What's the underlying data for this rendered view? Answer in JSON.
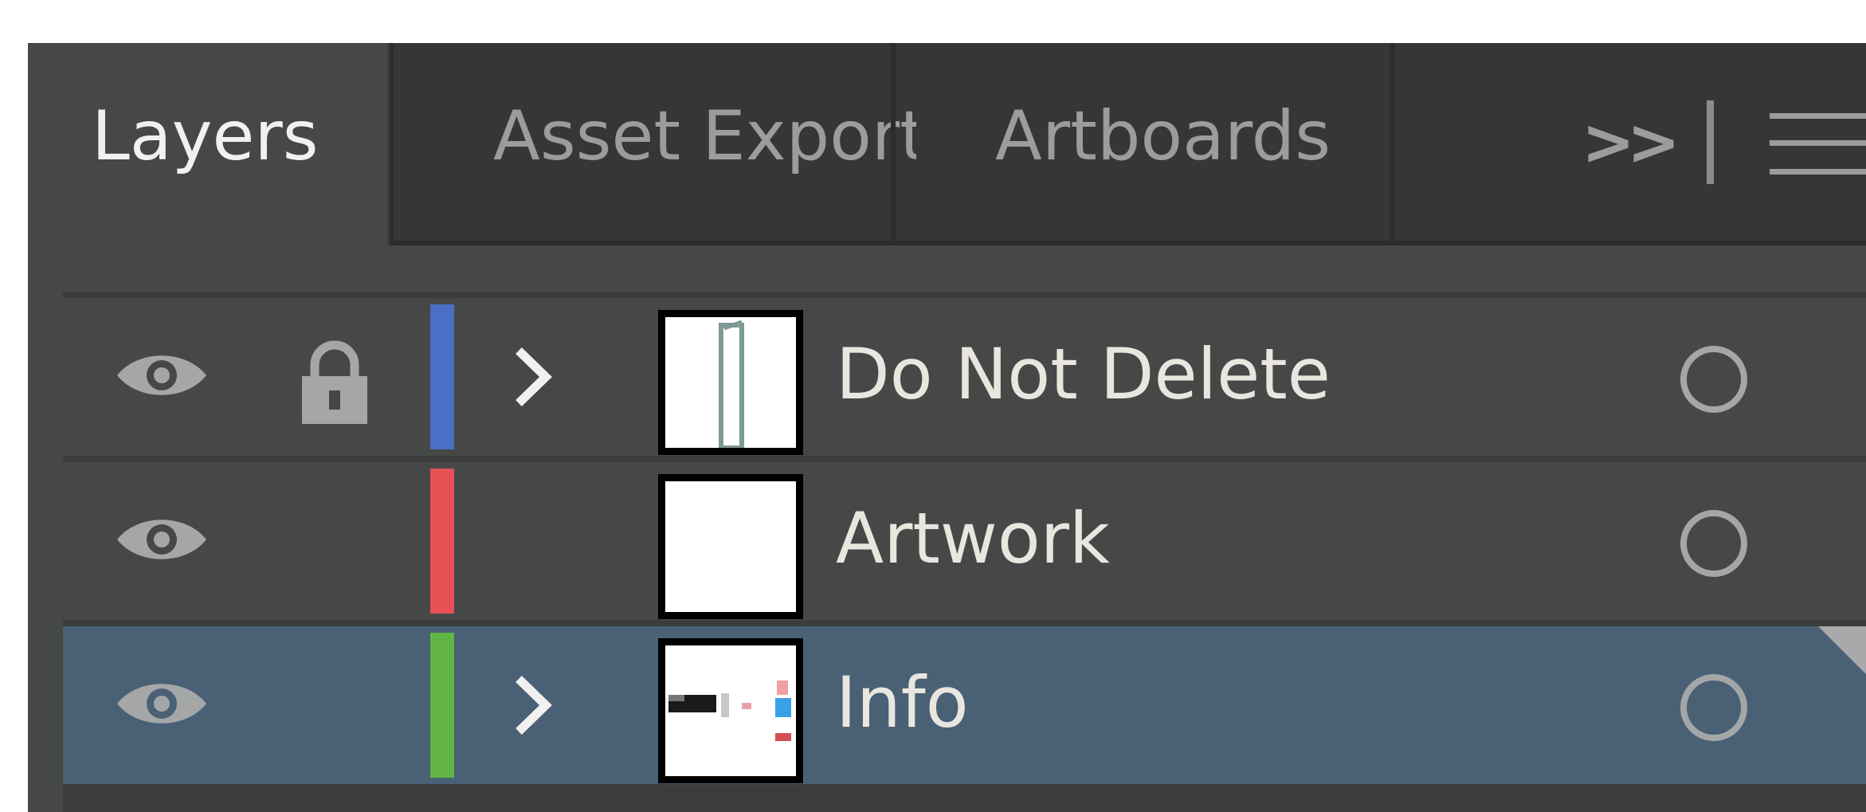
{
  "tabs": [
    {
      "label": "Layers",
      "active": true
    },
    {
      "label": "Asset Export",
      "active": false
    },
    {
      "label": "Artboards",
      "active": false
    }
  ],
  "tab_overflow": ">>",
  "icons": {
    "visibility": "eye-icon",
    "lock": "lock-icon",
    "expand": "chevron-right-icon",
    "target": "target-circle-icon",
    "overflow": "double-chevron-icon",
    "menu": "hamburger-menu-icon"
  },
  "layers": [
    {
      "name": "Do Not Delete",
      "visible": true,
      "locked": true,
      "expandable": true,
      "color": "#4a6fc4",
      "selected": false
    },
    {
      "name": "Artwork",
      "visible": true,
      "locked": false,
      "expandable": false,
      "color": "#e65155",
      "selected": false
    },
    {
      "name": "Info",
      "visible": true,
      "locked": false,
      "expandable": true,
      "color": "#62b545",
      "selected": true
    }
  ],
  "colors": {
    "panel_bg": "#464848",
    "tabbar_bg": "#343637",
    "selected_row": "#4a6075",
    "text": "#e9e6df"
  }
}
